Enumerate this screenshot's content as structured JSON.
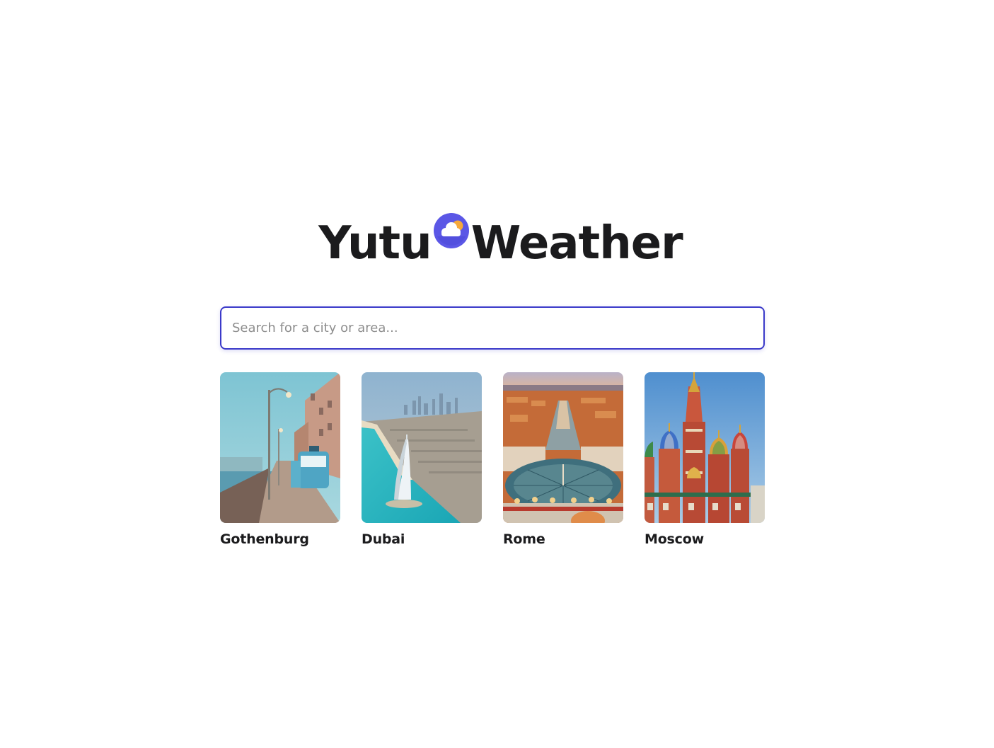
{
  "logo": {
    "word_left": "Yutu",
    "word_right": "Weather",
    "icon": "cloud-sun-icon",
    "icon_color": "#5b57e6",
    "sun_color": "#f7a93b"
  },
  "search": {
    "placeholder": "Search for a city or area...",
    "value": "",
    "border_color": "#3b3ac9"
  },
  "cities": [
    {
      "name": "Gothenburg",
      "image": "gothenburg-tram-street-photo"
    },
    {
      "name": "Dubai",
      "image": "dubai-burj-al-arab-photo"
    },
    {
      "name": "Rome",
      "image": "rome-st-peters-square-photo"
    },
    {
      "name": "Moscow",
      "image": "moscow-st-basils-cathedral-photo"
    }
  ]
}
